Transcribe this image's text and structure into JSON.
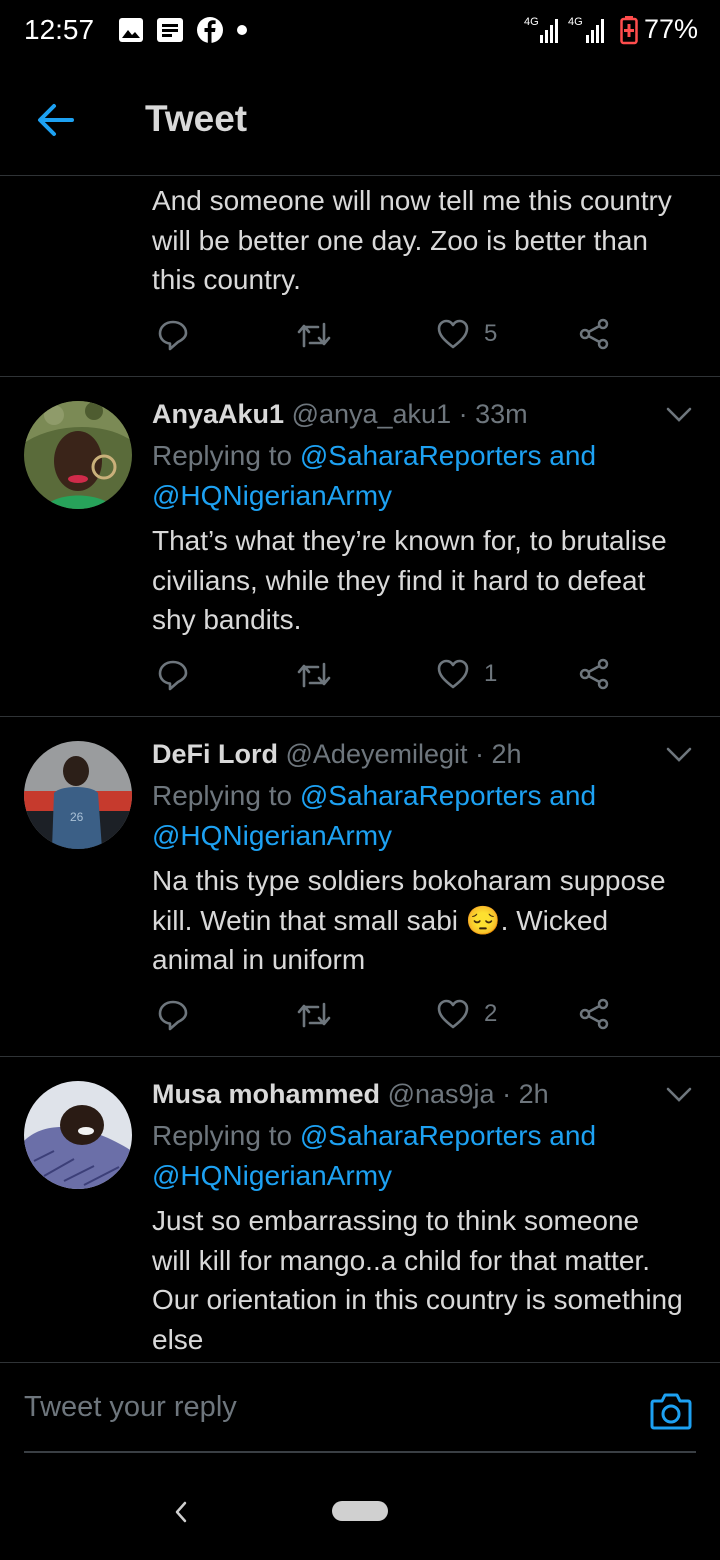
{
  "status_bar": {
    "time": "12:57",
    "notification_icons": [
      "image-icon",
      "message-icon",
      "facebook-icon",
      "dot-icon"
    ],
    "network_1": "4G",
    "network_2": "4G",
    "battery": "77%"
  },
  "app_bar": {
    "title": "Tweet"
  },
  "first_tweet": {
    "text": "And someone will now tell me this country will be better one day. Zoo is better than this country.",
    "likes": "5"
  },
  "replies": [
    {
      "name": "AnyaAku1",
      "handle": "@anya_aku1",
      "time": "· 33m",
      "replying_prefix": "Replying to ",
      "replying_to_1": "@SaharaReporters and",
      "replying_to_2": "@HQNigerianArmy",
      "text": "That’s what they’re known for, to brutalise civilians, while they find it hard to defeat shy bandits.",
      "likes": "1"
    },
    {
      "name": "DeFi Lord",
      "handle": "@Adeyemilegit",
      "time": "· 2h",
      "replying_prefix": "Replying to ",
      "replying_to_1": "@SaharaReporters and",
      "replying_to_2": "@HQNigerianArmy",
      "text": "Na this type soldiers bokoharam suppose kill. Wetin that small sabi 😔. Wicked animal in uniform",
      "likes": "2"
    },
    {
      "name": "Musa mohammed",
      "handle": "@nas9ja",
      "time": "· 2h",
      "replying_prefix": "Replying to ",
      "replying_to_1": "@SaharaReporters and",
      "replying_to_2": "@HQNigerianArmy",
      "text": "Just so embarrassing to think someone will kill for mango..a child for that matter. Our orientation in this country is something else"
    }
  ],
  "composer": {
    "placeholder": "Tweet your reply"
  },
  "colors": {
    "link": "#1da1f2",
    "muted": "#6e767d",
    "text": "#d9d9d9",
    "background": "#000000",
    "divider": "#2f3336"
  }
}
